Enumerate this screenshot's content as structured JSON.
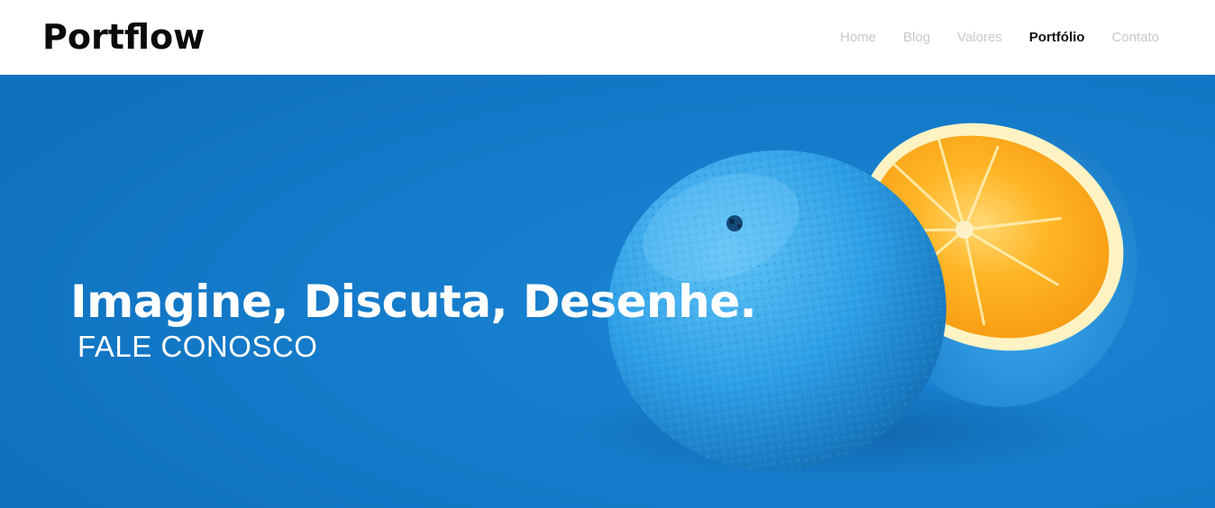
{
  "brand": {
    "logo_text": "Portflow"
  },
  "nav": {
    "items": [
      {
        "label": "Home",
        "active": false
      },
      {
        "label": "Blog",
        "active": false
      },
      {
        "label": "Valores",
        "active": false
      },
      {
        "label": "Portfólio",
        "active": true
      },
      {
        "label": "Contato",
        "active": false
      }
    ]
  },
  "hero": {
    "headline": "Imagine, Discuta, Desenhe.",
    "cta": "FALE CONOSCO",
    "background_color": "#117ac8",
    "image": "blue-painted-orange-halves"
  }
}
